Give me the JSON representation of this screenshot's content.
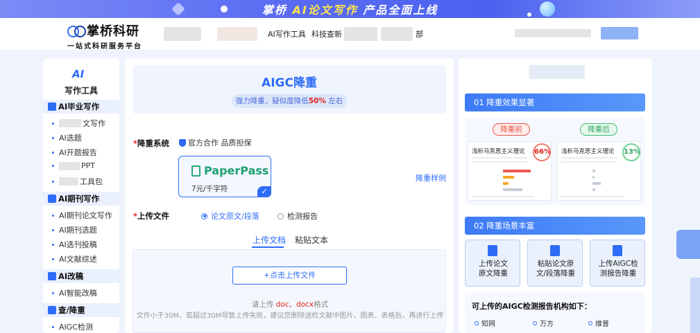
{
  "banner": {
    "brand": "掌桥",
    "highlight": "AI论文写作",
    "rest": "产品全面上线"
  },
  "header": {
    "logo_name": "掌桥科研",
    "logo_sub": "一站式科研服务平台",
    "nav": [
      "AI写作工具",
      "科技查新"
    ],
    "nav_partial": "部"
  },
  "sidebar": {
    "icon_text": "AI",
    "title": "写作工具",
    "sections": [
      {
        "label": "AI毕业写作",
        "items": [
          "文写作",
          "AI选题",
          "AI开题报告",
          "PPT",
          "工具包"
        ]
      },
      {
        "label": "AI期刊写作",
        "items": [
          "AI期刊论文写作",
          "AI期刊选题",
          "AI选刊投稿",
          "AI文献综述"
        ]
      },
      {
        "label": "AI改稿",
        "items": [
          "AI智能改稿"
        ]
      },
      {
        "label": "查/降重",
        "items": [
          "AIGC检测"
        ]
      }
    ]
  },
  "main": {
    "title": "AIGC降重",
    "subtitle_pre": "强力降重，疑似度降低",
    "subtitle_pct": "50%",
    "subtitle_post": " 左右",
    "system_label": "降重系统",
    "system_note": "官方合作 品质担保",
    "card_name": "PaperPass",
    "card_price": "7元/千字符",
    "sample_link": "降重样例",
    "file_label": "上传文件",
    "radio_options": [
      "论文原文/段落",
      "检测报告"
    ],
    "tabs": [
      "上传文档",
      "粘贴文本"
    ],
    "upload_button": "+点击上传文件",
    "hint_pre": "请上传 ",
    "hint_formats": "doc、docx",
    "hint_post": "格式",
    "hint2": "文件小于30M，若超过30M导致上传失败，建议您删除送检文献中图片、图表、表格后，再进行上传"
  },
  "right": {
    "section1": "01 降重效果显著",
    "before_label": "降重前",
    "after_label": "降重后",
    "before_title": "浅析马克思主义理论",
    "after_title": "浅析马克思主义理论",
    "before_pct": "66%",
    "after_pct": "13%",
    "section2": "02 降重场景丰富",
    "scenarios": [
      "上传论文\n原文降重",
      "粘贴论文原\n文/段落降重",
      "上传AIGC检\n测报告降重"
    ],
    "agencies_title": "可上传的AIGC检测报告机构如下：",
    "agencies": [
      "知网",
      "万方",
      "维普"
    ]
  }
}
